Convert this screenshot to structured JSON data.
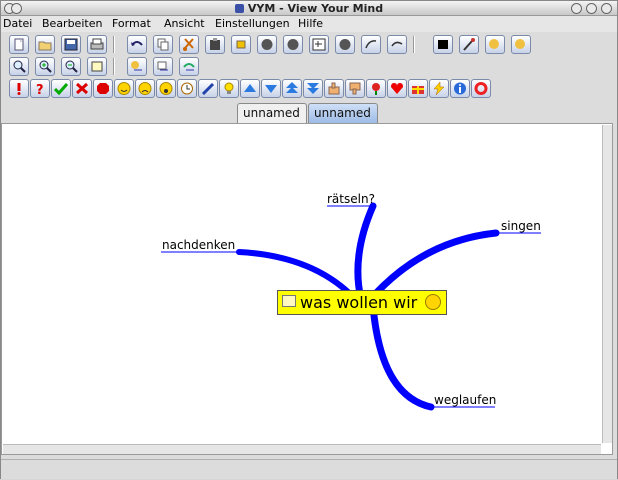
{
  "window": {
    "title": "VYM - View Your Mind"
  },
  "menubar": {
    "items": [
      {
        "label": "Datei"
      },
      {
        "label": "Bearbeiten"
      },
      {
        "label": "Format"
      },
      {
        "label": "Ansicht"
      },
      {
        "label": "Einstellungen"
      },
      {
        "label": "Hilfe"
      }
    ]
  },
  "toolbar1": {
    "icons": [
      "new-file-icon",
      "open-file-icon",
      "save-file-icon",
      "print-icon",
      "undo-icon",
      "copy-icon",
      "cut-icon",
      "paste-icon",
      "move-up-icon",
      "circle-icon",
      "circle-icon",
      "branch-icon",
      "circle-icon",
      "branch-add-icon",
      "branch-delete-icon",
      "color-icon",
      "pick-color-icon",
      "format-painter-icon",
      "format-painter-icon"
    ]
  },
  "toolbar2": {
    "icons": [
      "zoom-reset-icon",
      "zoom-in-icon",
      "zoom-out-icon",
      "note-icon",
      "link-icon",
      "link-icon",
      "link-icon"
    ]
  },
  "toolbar3": {
    "icons": [
      "exclamation-icon",
      "question-icon",
      "check-icon",
      "cross-icon",
      "stop-icon",
      "smiley-good-icon",
      "smiley-bad-icon",
      "smiley-omg-icon",
      "clock-icon",
      "pen-icon",
      "lightbulb-icon",
      "arrow-up-icon",
      "arrow-down-icon",
      "double-arrow-up-icon",
      "double-arrow-down-icon",
      "thumb-up-icon",
      "thumb-down-icon",
      "rose-icon",
      "heart-icon",
      "present-icon",
      "flash-icon",
      "info-icon",
      "lifebelt-icon"
    ]
  },
  "tabs": [
    {
      "label": "unnamed",
      "active": false
    },
    {
      "label": "unnamed",
      "active": true
    }
  ],
  "mindmap": {
    "center": "was wollen wir",
    "branches": {
      "b1": "rätseln?",
      "b2": "singen",
      "b3": "nachdenken",
      "b4": "weglaufen"
    }
  },
  "colors": {
    "branch": "#0000ff",
    "center_bg": "#ffff00",
    "tab_active": "#9dbbe6"
  }
}
